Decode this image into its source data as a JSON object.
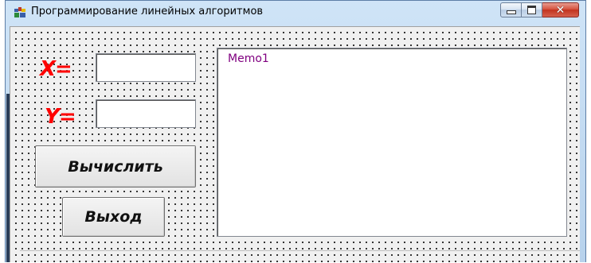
{
  "window": {
    "title": "Программирование линейных алгоритмов",
    "icon": "delphi-app-icon",
    "controls": [
      "minimize-icon",
      "maximize-icon",
      "close-icon"
    ],
    "close_glyph": "✕"
  },
  "form": {
    "x_label": "X=",
    "y_label": "Y=",
    "x_value": "",
    "y_value": "",
    "calc_button": "Вычислить",
    "exit_button": "Выход",
    "memo_text": "Memo1"
  },
  "colors": {
    "label_color": "#ff0000",
    "memo_text_color": "#800080",
    "client_bg": "#f0f0f0"
  }
}
